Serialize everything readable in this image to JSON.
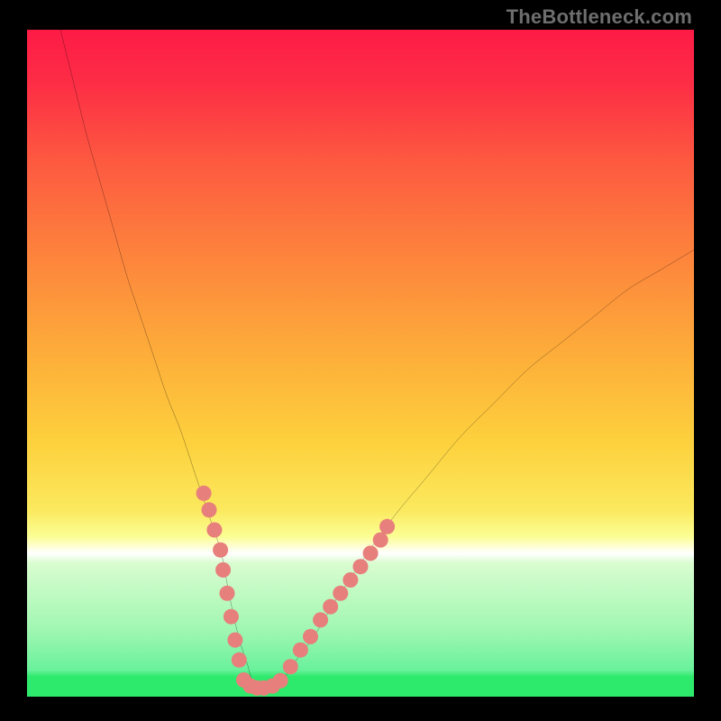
{
  "watermark": "TheBottleneck.com",
  "colors": {
    "gradient_top": "#fd1b46",
    "gradient_mid": "#fdd13d",
    "gradient_low": "#fbfe94",
    "gradient_green": "#2eea6c",
    "black": "#000000",
    "curve": "#000000",
    "marker": "#e77f7c"
  },
  "chart_data": {
    "type": "line",
    "title": "",
    "xlabel": "",
    "ylabel": "",
    "xlim": [
      0,
      100
    ],
    "ylim": [
      0,
      100
    ],
    "series": [
      {
        "name": "bottleneck-curve",
        "x": [
          5,
          7,
          9,
          11,
          13,
          15,
          17,
          19,
          21,
          23,
          25,
          27,
          29,
          30,
          31,
          32,
          33,
          34,
          36,
          38,
          40,
          43,
          46,
          50,
          55,
          60,
          65,
          70,
          75,
          80,
          85,
          90,
          95,
          100
        ],
        "y": [
          100,
          92,
          84,
          77,
          70,
          63,
          57,
          51,
          45,
          40,
          34,
          28,
          22,
          17,
          12,
          8,
          5,
          2,
          1,
          2,
          5,
          9,
          14,
          20,
          27,
          33,
          39,
          44,
          49,
          53,
          57,
          61,
          64,
          67
        ]
      }
    ],
    "markers": [
      {
        "name": "left-cluster",
        "x": [
          26.5,
          27.3,
          28.1,
          29.0,
          29.4,
          30.0,
          30.6,
          31.2,
          31.8
        ],
        "y": [
          30.5,
          28.0,
          25.0,
          22.0,
          19.0,
          15.5,
          12.0,
          8.5,
          5.5
        ]
      },
      {
        "name": "trough-cluster",
        "x": [
          32.5,
          33.5,
          34.5,
          35.5,
          36.8,
          38.0
        ],
        "y": [
          2.5,
          1.6,
          1.3,
          1.3,
          1.6,
          2.4
        ]
      },
      {
        "name": "right-cluster",
        "x": [
          39.5,
          41.0,
          42.5,
          44.0,
          45.5,
          47.0,
          48.5,
          50.0,
          51.5,
          53.0,
          54.0
        ],
        "y": [
          4.5,
          7.0,
          9.0,
          11.5,
          13.5,
          15.5,
          17.5,
          19.5,
          21.5,
          23.5,
          25.5
        ]
      }
    ],
    "bands": [
      {
        "name": "pale-yellow",
        "y_from": 22,
        "y_to": 25.5,
        "color": "#fbfe94"
      },
      {
        "name": "white",
        "y_from": 21,
        "y_to": 22,
        "color": "#ffffff"
      },
      {
        "name": "pale-green",
        "y_from": 10,
        "y_to": 21,
        "color_top": "#d9fccf",
        "color_bot": "#69f19b"
      },
      {
        "name": "green",
        "y_from": 0,
        "y_to": 3.5,
        "color": "#2eea6c"
      }
    ]
  }
}
